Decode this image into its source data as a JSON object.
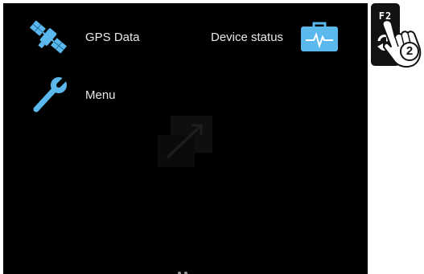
{
  "menu": {
    "gps_data": {
      "label": "GPS Data",
      "icon": "satellite-icon"
    },
    "device_status": {
      "label": "Device status",
      "icon": "medical-case-icon"
    },
    "menu": {
      "label": "Menu",
      "icon": "wrench-icon"
    }
  },
  "hardware_key": {
    "label": "F2",
    "icon": "cycle-arrows-icon"
  },
  "instruction": {
    "step": "2",
    "icon": "pointing-hand-icon"
  },
  "colors": {
    "screen_background": "#000000",
    "label_text": "#e9e9e9",
    "icon_accent": "#5bb8ec",
    "key_background": "#121212"
  }
}
